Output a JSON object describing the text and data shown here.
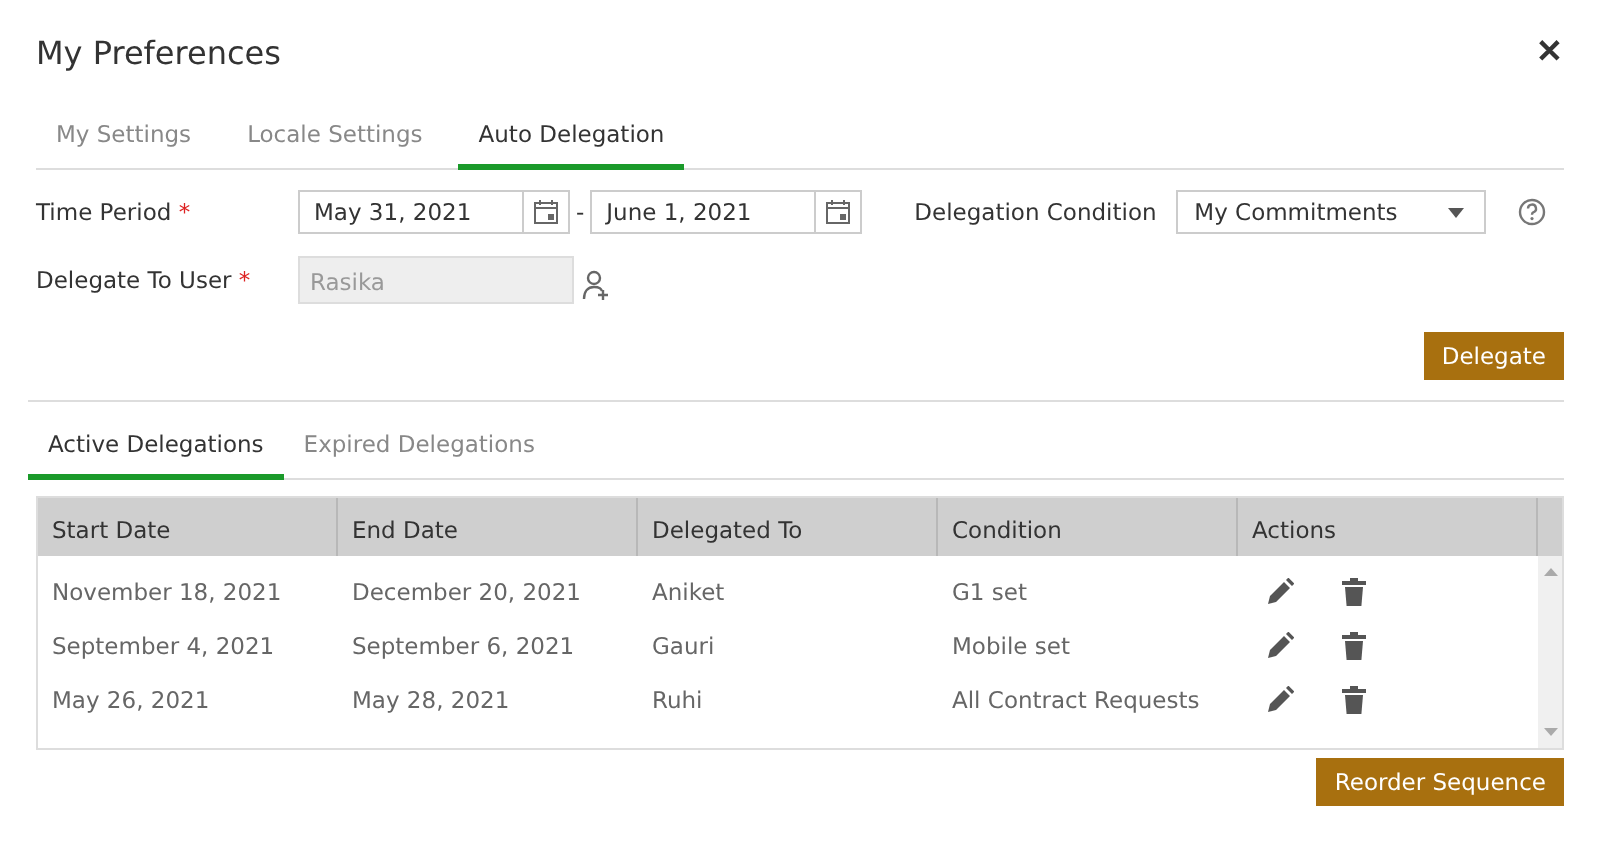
{
  "dialog": {
    "title": "My Preferences",
    "close": "✕"
  },
  "tabs": [
    {
      "label": "My Settings",
      "selected": false
    },
    {
      "label": "Locale Settings",
      "selected": false
    },
    {
      "label": "Auto Delegation",
      "selected": true
    }
  ],
  "form": {
    "time_period": {
      "label": "Time Period",
      "required_mark": "*",
      "from": "May 31, 2021",
      "separator": "-",
      "to": "June 1, 2021"
    },
    "delegation_condition": {
      "label": "Delegation Condition",
      "value": "My Commitments"
    },
    "delegate_to_user": {
      "label": "Delegate To User",
      "required_mark": "*",
      "value": "Rasika",
      "disabled": true
    },
    "delegate_button": "Delegate"
  },
  "subtabs": [
    {
      "label": "Active Delegations",
      "selected": true
    },
    {
      "label": "Expired Delegations",
      "selected": false
    }
  ],
  "table": {
    "columns": [
      "Start Date",
      "End Date",
      "Delegated To",
      "Condition",
      "Actions"
    ],
    "rows": [
      [
        "November 18, 2021",
        "December 20, 2021",
        "Aniket",
        "G1 set"
      ],
      [
        "September 4, 2021",
        "September 6, 2021",
        "Gauri",
        "Mobile set"
      ],
      [
        "May 26, 2021",
        "May 28, 2021",
        "Ruhi",
        "All Contract Requests"
      ]
    ]
  },
  "reorder_button": "Reorder Sequence"
}
